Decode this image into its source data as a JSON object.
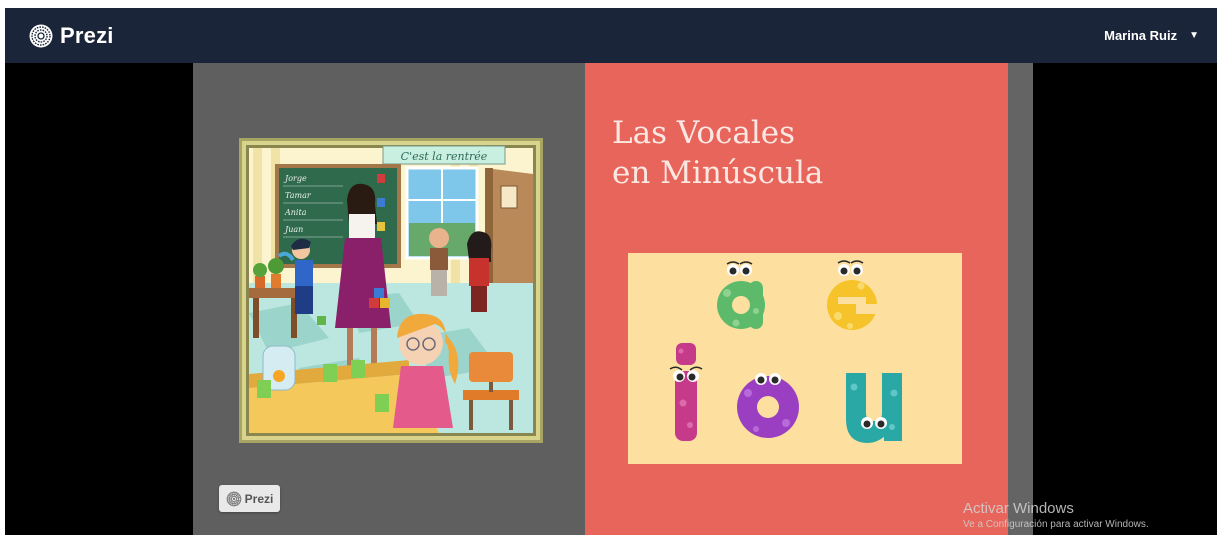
{
  "navbar": {
    "brand": "Prezi",
    "logo_icon": "prezi-logo-icon",
    "user_name": "Marina Ruiz",
    "user_menu_icon": "caret-down-icon"
  },
  "slide": {
    "title_line1": "Las Vocales",
    "title_line2": "en Minúscula",
    "image_banner": "C'est la rentrée",
    "chalkboard_names": [
      "Jorge",
      "Tamar",
      "Anita",
      "Juan"
    ],
    "vowels": [
      "a",
      "e",
      "i",
      "o",
      "u"
    ],
    "badge_text": "Prezi",
    "colors": {
      "panel_left": "#5f5f5f",
      "panel_right": "#e8655b",
      "vowel_card": "#fde0a0",
      "navbar": "#1b2539"
    }
  },
  "watermark": {
    "title": "Activar Windows",
    "subtitle": "Ve a Configuración para activar Windows."
  }
}
